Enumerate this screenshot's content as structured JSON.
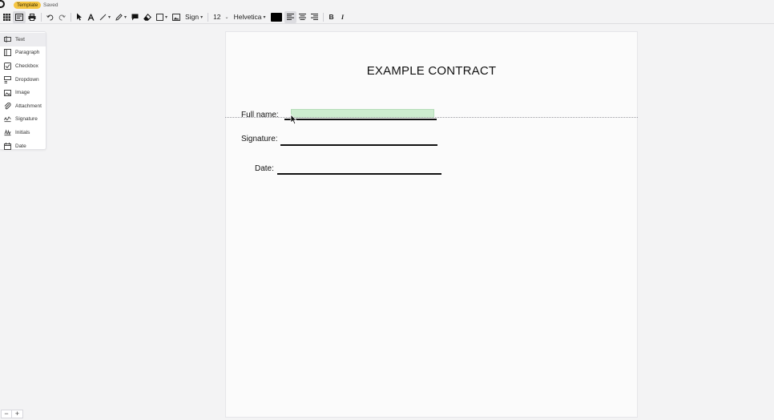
{
  "header": {
    "badge": "Template",
    "status": "Saved"
  },
  "toolbar": {
    "sign_label": "Sign",
    "font_size": "12",
    "font_family": "Helvetica",
    "color": "#000000",
    "bold_label": "B",
    "italic_label": "I"
  },
  "panel": {
    "items": [
      {
        "label": "Text",
        "icon": "text-field-icon"
      },
      {
        "label": "Paragraph",
        "icon": "paragraph-icon"
      },
      {
        "label": "Checkbox",
        "icon": "checkbox-icon"
      },
      {
        "label": "Dropdown",
        "icon": "dropdown-icon"
      },
      {
        "label": "Image",
        "icon": "image-icon"
      },
      {
        "label": "Attachment",
        "icon": "paperclip-icon"
      },
      {
        "label": "Signature",
        "icon": "signature-icon"
      },
      {
        "label": "Initials",
        "icon": "initials-icon"
      },
      {
        "label": "Date",
        "icon": "calendar-icon"
      }
    ]
  },
  "document": {
    "title": "EXAMPLE CONTRACT",
    "fields": [
      {
        "label": "Full name:"
      },
      {
        "label": "Signature:"
      },
      {
        "label": "Date:"
      }
    ]
  },
  "zoom": {
    "out_label": "−",
    "in_label": "+"
  },
  "colors": {
    "badge": "#f5c542",
    "field_highlight": "#cdeccf"
  }
}
